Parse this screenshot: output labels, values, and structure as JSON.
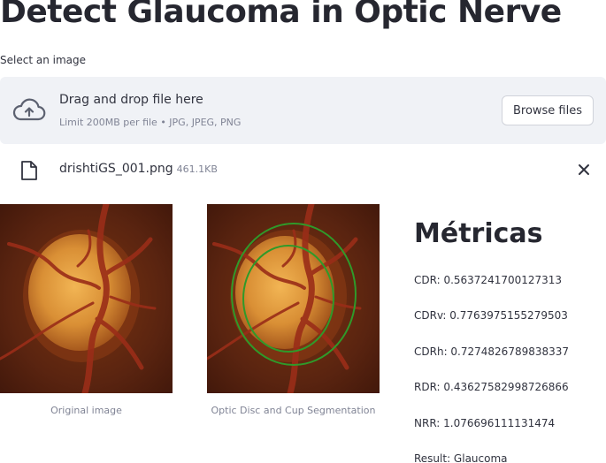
{
  "page": {
    "title": "Detect Glaucoma in Optic Nerve",
    "select_label": "Select an image"
  },
  "uploader": {
    "title": "Drag and drop file here",
    "subtitle": "Limit 200MB per file • JPG, JPEG, PNG",
    "browse_label": "Browse files",
    "upload_icon": "cloud-upload-icon"
  },
  "file": {
    "name": "drishtiGS_001.png",
    "size": "461.1KB",
    "icon": "file-icon",
    "remove_icon": "close-icon"
  },
  "images": {
    "original_caption": "Original image",
    "segmentation_caption": "Optic Disc and Cup Segmentation",
    "contour_color": "#2f9a2a"
  },
  "metrics": {
    "title": "Métricas",
    "items": [
      "CDR: 0.5637241700127313",
      "CDRv: 0.7763975155279503",
      "CDRh: 0.7274826789838337",
      "RDR: 0.43627582998726866",
      "NRR: 1.076696111131474",
      "Result: Glaucoma"
    ]
  }
}
